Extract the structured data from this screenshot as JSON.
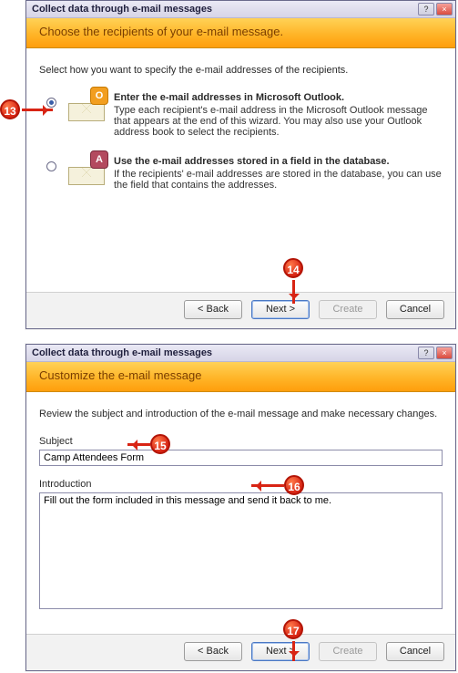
{
  "callouts": {
    "c13": "13",
    "c14": "14",
    "c15": "15",
    "c16": "16",
    "c17": "17"
  },
  "window_title": "Collect data through e-mail messages",
  "titlebar": {
    "help": "?",
    "close": "×"
  },
  "buttons": {
    "back": "< Back",
    "next": "Next >",
    "create": "Create",
    "cancel": "Cancel"
  },
  "wizard1": {
    "heading": "Choose the recipients of your e-mail message.",
    "instruction": "Select how you want to specify the e-mail addresses of the recipients.",
    "opt1": {
      "title": "Enter the e-mail addresses in Microsoft Outlook.",
      "desc": "Type each recipient's e-mail address in the Microsoft Outlook message that appears at the end of this wizard. You may also use your Outlook address book to select the recipients."
    },
    "opt2": {
      "title": "Use the e-mail addresses stored in a field in the database.",
      "desc": "If the recipients' e-mail addresses are stored in the database, you can use the field that contains the addresses."
    }
  },
  "wizard2": {
    "heading": "Customize the e-mail message",
    "instruction": "Review the subject and introduction of the e-mail message and make necessary changes.",
    "subject_label": "Subject",
    "subject_value": "Camp Attendees Form",
    "intro_label": "Introduction",
    "intro_value": "Fill out the form included in this message and send it back to me."
  }
}
